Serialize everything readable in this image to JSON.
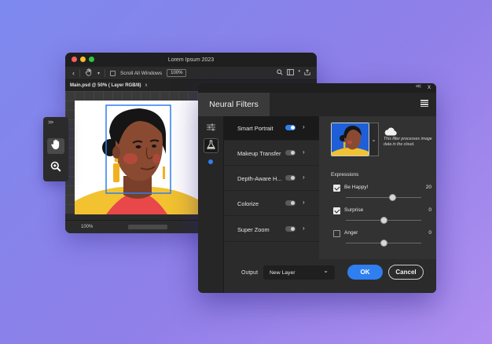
{
  "editor": {
    "title": "Lorem Ipsum 2023",
    "scroll_all_label": "Scroll All Windows",
    "zoom_value": "100%",
    "doc_tab": "Main.psd @ 50% ( Layer RGB/8)",
    "doc_tab_close": "x",
    "status_zoom": "100%"
  },
  "tools": {
    "expand": ">>",
    "items": [
      {
        "icon": "hand-icon",
        "active": true
      },
      {
        "icon": "zoom-icon",
        "active": false
      }
    ]
  },
  "panel": {
    "collapse": "<<",
    "close": "x",
    "title": "Neural Filters",
    "filters": [
      {
        "label": "Smart Portrait",
        "enabled": true,
        "selected": true
      },
      {
        "label": "Makeup Transfer",
        "enabled": false,
        "selected": false
      },
      {
        "label": "Depth-Aware H...",
        "enabled": false,
        "selected": false
      },
      {
        "label": "Colorize",
        "enabled": false,
        "selected": false
      },
      {
        "label": "Super Zoom",
        "enabled": false,
        "selected": false
      }
    ],
    "cloud_note": "This filter processes image data in the cloud.",
    "expressions_label": "Expressions",
    "expressions": [
      {
        "label": "Be Happy!",
        "checked": true,
        "value": "20",
        "level": 0.62
      },
      {
        "label": "Surprise",
        "checked": true,
        "value": "0",
        "level": 0.5
      },
      {
        "label": "Anger",
        "checked": false,
        "value": "0",
        "level": 0.5
      }
    ],
    "output_label": "Output",
    "output_value": "New Layer",
    "ok_label": "OK",
    "cancel_label": "Cancel"
  },
  "colors": {
    "accent": "#2f7ff0",
    "selection": "#2f7ff0",
    "skin": "#8a4a32",
    "shirt": "#f2c230",
    "earring": "#f2b020"
  }
}
